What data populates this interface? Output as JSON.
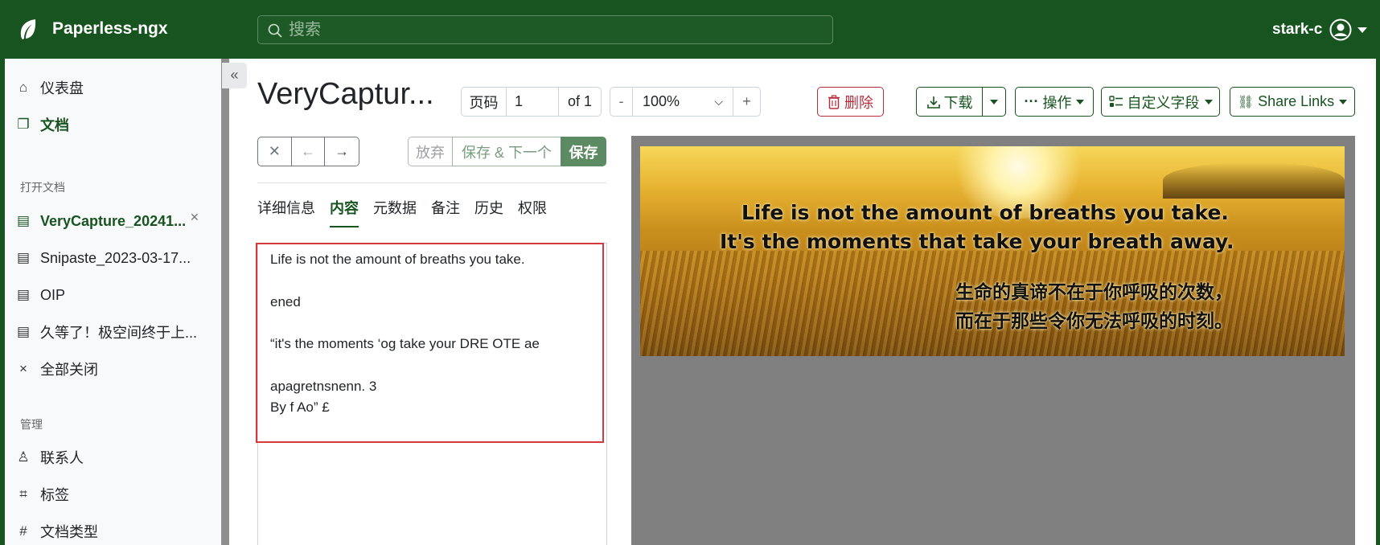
{
  "app": {
    "brand": "Paperless-ngx",
    "user": "stark-c"
  },
  "search": {
    "placeholder": "搜索"
  },
  "sidebar": {
    "dashboard": "仪表盘",
    "documents": "文档",
    "open_docs_heading": "打开文档",
    "open_docs": [
      "VeryCapture_20241...",
      "Snipaste_2023-03-17...",
      "OIP",
      "久等了！极空间终于上..."
    ],
    "close_all": "全部关闭",
    "manage_heading": "管理",
    "correspondents": "联系人",
    "tags": "标签",
    "document_types": "文档类型"
  },
  "document": {
    "title": "VeryCaptur...",
    "page_label": "页码",
    "page_value": "1",
    "page_of": "of 1",
    "zoom_minus": "-",
    "zoom_value": "100%",
    "zoom_plus": "+",
    "delete": "删除",
    "download": "下载",
    "actions": "操作",
    "custom_fields": "自定义字段",
    "share_links": "Share Links",
    "discard": "放弃",
    "save_next": "保存 & 下一个",
    "save": "保存",
    "tabs": [
      "详细信息",
      "内容",
      "元数据",
      "备注",
      "历史",
      "权限"
    ],
    "content_lines": [
      "Life is not the amount of breaths you take.",
      "ened",
      "“it's the moments ‘og take your DRE OTE ae",
      "apagretnsnenn. 3",
      "By f Ao” £"
    ]
  },
  "preview": {
    "line1": "Life is not the amount of breaths you take.",
    "line2": "It's the moments that take your breath away.",
    "line3": "生命的真谛不在于你呼吸的次数，",
    "line4": "而在于那些令你无法呼吸的时刻。"
  },
  "colors": {
    "brand": "#17541f",
    "danger": "#b52e3c",
    "highlight": "#d6393b",
    "preview_bg": "#808080"
  }
}
